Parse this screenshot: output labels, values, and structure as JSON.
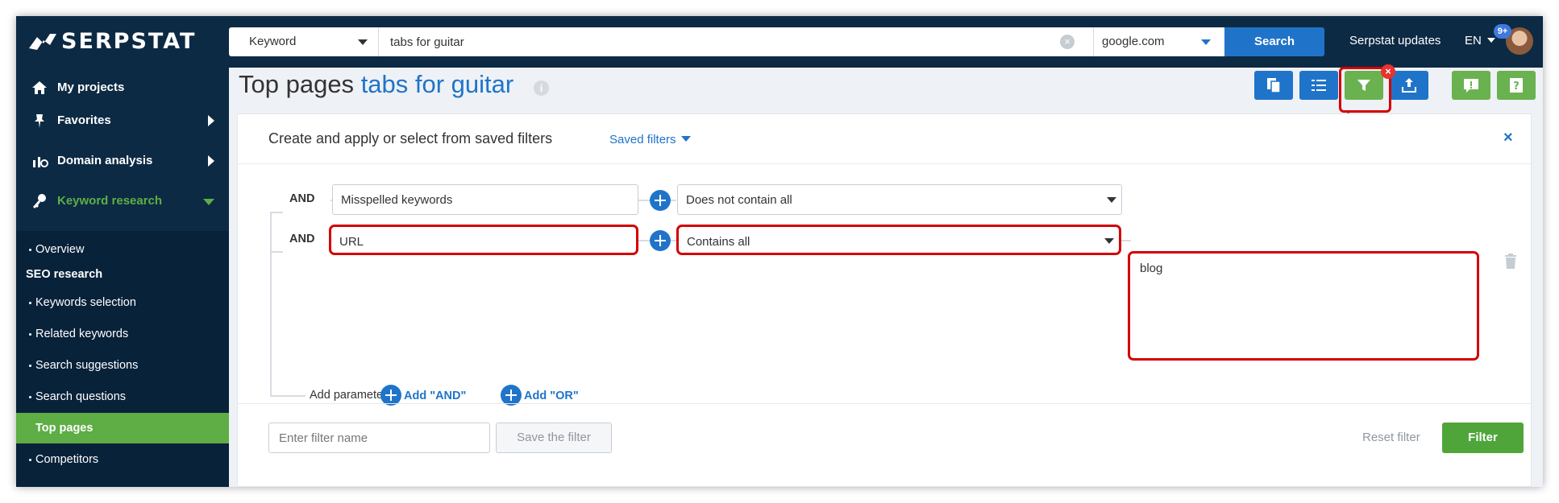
{
  "header": {
    "logo_text": "SERPSTAT",
    "search_type": "Keyword",
    "search_value": "tabs for guitar",
    "engine": "google.com",
    "search_button": "Search",
    "updates": "Serpstat updates",
    "language": "EN",
    "notification_count": "9+"
  },
  "sidebar": {
    "main": [
      {
        "label": "My projects",
        "icon": "home-icon"
      },
      {
        "label": "Favorites",
        "icon": "pin-icon"
      },
      {
        "label": "Domain analysis",
        "icon": "chart-icon"
      },
      {
        "label": "Keyword research",
        "icon": "key-icon"
      }
    ],
    "overview": "Overview",
    "seo_heading": "SEO research",
    "seo_items": [
      "Keywords selection",
      "Related keywords",
      "Search suggestions",
      "Search questions",
      "Top pages",
      "Competitors"
    ],
    "active_color": "#5fad45",
    "keyword_color": "#5bb045"
  },
  "page": {
    "title": "Top pages",
    "keyword": "tabs for guitar"
  },
  "filter_panel": {
    "title": "Create and apply or select from saved filters",
    "saved_filters": "Saved filters",
    "rows": [
      {
        "conj": "AND",
        "field": "Misspelled keywords",
        "condition": "Does not contain all"
      },
      {
        "conj": "AND",
        "field": "URL",
        "condition": "Contains all",
        "value": "blog"
      }
    ],
    "add_parameter": "Add parameter:",
    "add_and": "Add \"AND\"",
    "add_or": "Add \"OR\"",
    "filter_name_placeholder": "Enter filter name",
    "save_button": "Save the filter",
    "reset_button": "Reset filter",
    "apply_button": "Filter"
  },
  "colors": {
    "nav": "#0d2a44",
    "accent_blue": "#1f74c9",
    "accent_green": "#6ab24f",
    "highlight_red": "#d40000"
  }
}
